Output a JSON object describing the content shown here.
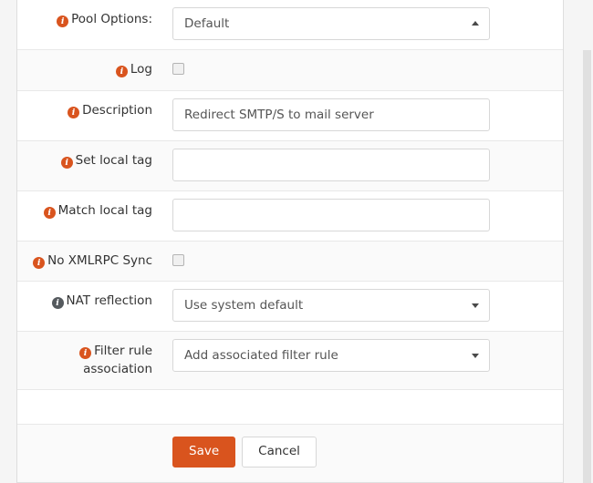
{
  "form": {
    "rows": [
      {
        "id": "pool-options",
        "label": "Pool Options:",
        "icon": "info-icon",
        "icon_color": "#d9541e",
        "control": "select",
        "value": "Default",
        "caret": "up",
        "striped": false
      },
      {
        "id": "log",
        "label": "Log",
        "icon": "info-icon",
        "icon_color": "#d9541e",
        "control": "checkbox",
        "value": "",
        "checked": false,
        "striped": true
      },
      {
        "id": "description",
        "label": "Description",
        "icon": "info-icon",
        "icon_color": "#d9541e",
        "control": "text",
        "value": "Redirect SMTP/S to mail server",
        "placeholder": "",
        "striped": false
      },
      {
        "id": "set-local-tag",
        "label": "Set local tag",
        "icon": "info-icon",
        "icon_color": "#d9541e",
        "control": "text",
        "value": "",
        "placeholder": "",
        "striped": true
      },
      {
        "id": "match-local-tag",
        "label": "Match local tag",
        "icon": "info-icon",
        "icon_color": "#d9541e",
        "control": "text",
        "value": "",
        "placeholder": "",
        "striped": false
      },
      {
        "id": "no-xmlrpc-sync",
        "label": "No XMLRPC Sync",
        "icon": "info-icon",
        "icon_color": "#d9541e",
        "control": "checkbox",
        "value": "",
        "checked": false,
        "striped": true
      },
      {
        "id": "nat-reflection",
        "label": "NAT reflection",
        "icon": "info-icon",
        "icon_color": "#555a5e",
        "control": "select",
        "value": "Use system default",
        "caret": "down",
        "striped": false
      },
      {
        "id": "filter-rule-association",
        "label": "Filter rule association",
        "icon": "info-icon",
        "icon_color": "#d9541e",
        "control": "select",
        "value": "Add associated filter rule",
        "caret": "down",
        "striped": true
      },
      {
        "id": "spacer",
        "label": "",
        "icon": "",
        "control": "none",
        "value": "",
        "striped": false
      }
    ]
  },
  "actions": {
    "save_label": "Save",
    "cancel_label": "Cancel",
    "save_color": "#d9541e"
  },
  "icons": {
    "info_glyph": "i"
  }
}
